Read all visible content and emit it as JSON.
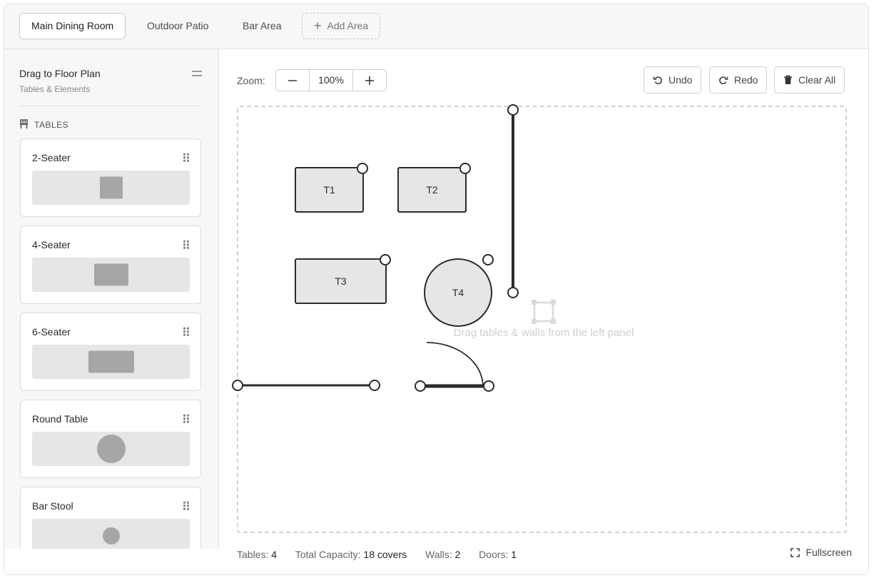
{
  "tabs": [
    {
      "label": "Main Dining Room",
      "active": true
    },
    {
      "label": "Outdoor Patio",
      "active": false
    },
    {
      "label": "Bar Area",
      "active": false
    }
  ],
  "add_area_label": "Add Area",
  "sidebar": {
    "title": "Drag to Floor Plan",
    "subtitle": "Tables & Elements",
    "section_label": "TABLES",
    "section_icon": "chair-icon",
    "items": [
      {
        "label": "2-Seater",
        "shape": "square-small"
      },
      {
        "label": "4-Seater",
        "shape": "square"
      },
      {
        "label": "6-Seater",
        "shape": "rectangle"
      },
      {
        "label": "Round Table",
        "shape": "circle"
      },
      {
        "label": "Bar Stool",
        "shape": "circle-small"
      }
    ]
  },
  "toolbar": {
    "zoom_label": "Zoom:",
    "zoom_value": "100%",
    "undo_label": "Undo",
    "redo_label": "Redo",
    "clear_label": "Clear All"
  },
  "canvas": {
    "hint": "Drag tables & walls from the left panel",
    "tables": [
      {
        "id": "T1",
        "shape": "rect"
      },
      {
        "id": "T2",
        "shape": "rect"
      },
      {
        "id": "T3",
        "shape": "rect"
      },
      {
        "id": "T4",
        "shape": "round"
      }
    ]
  },
  "status": {
    "tables_label": "Tables:",
    "tables_value": "4",
    "capacity_label": "Total Capacity:",
    "capacity_value": "18 covers",
    "walls_label": "Walls:",
    "walls_value": "2",
    "doors_label": "Doors:",
    "doors_value": "1"
  },
  "fullscreen_label": "Fullscreen",
  "colors": {
    "table_fill": "#e6e6e6",
    "stroke": "#2b2b2b",
    "preview_shape": "#a6a6a6"
  }
}
